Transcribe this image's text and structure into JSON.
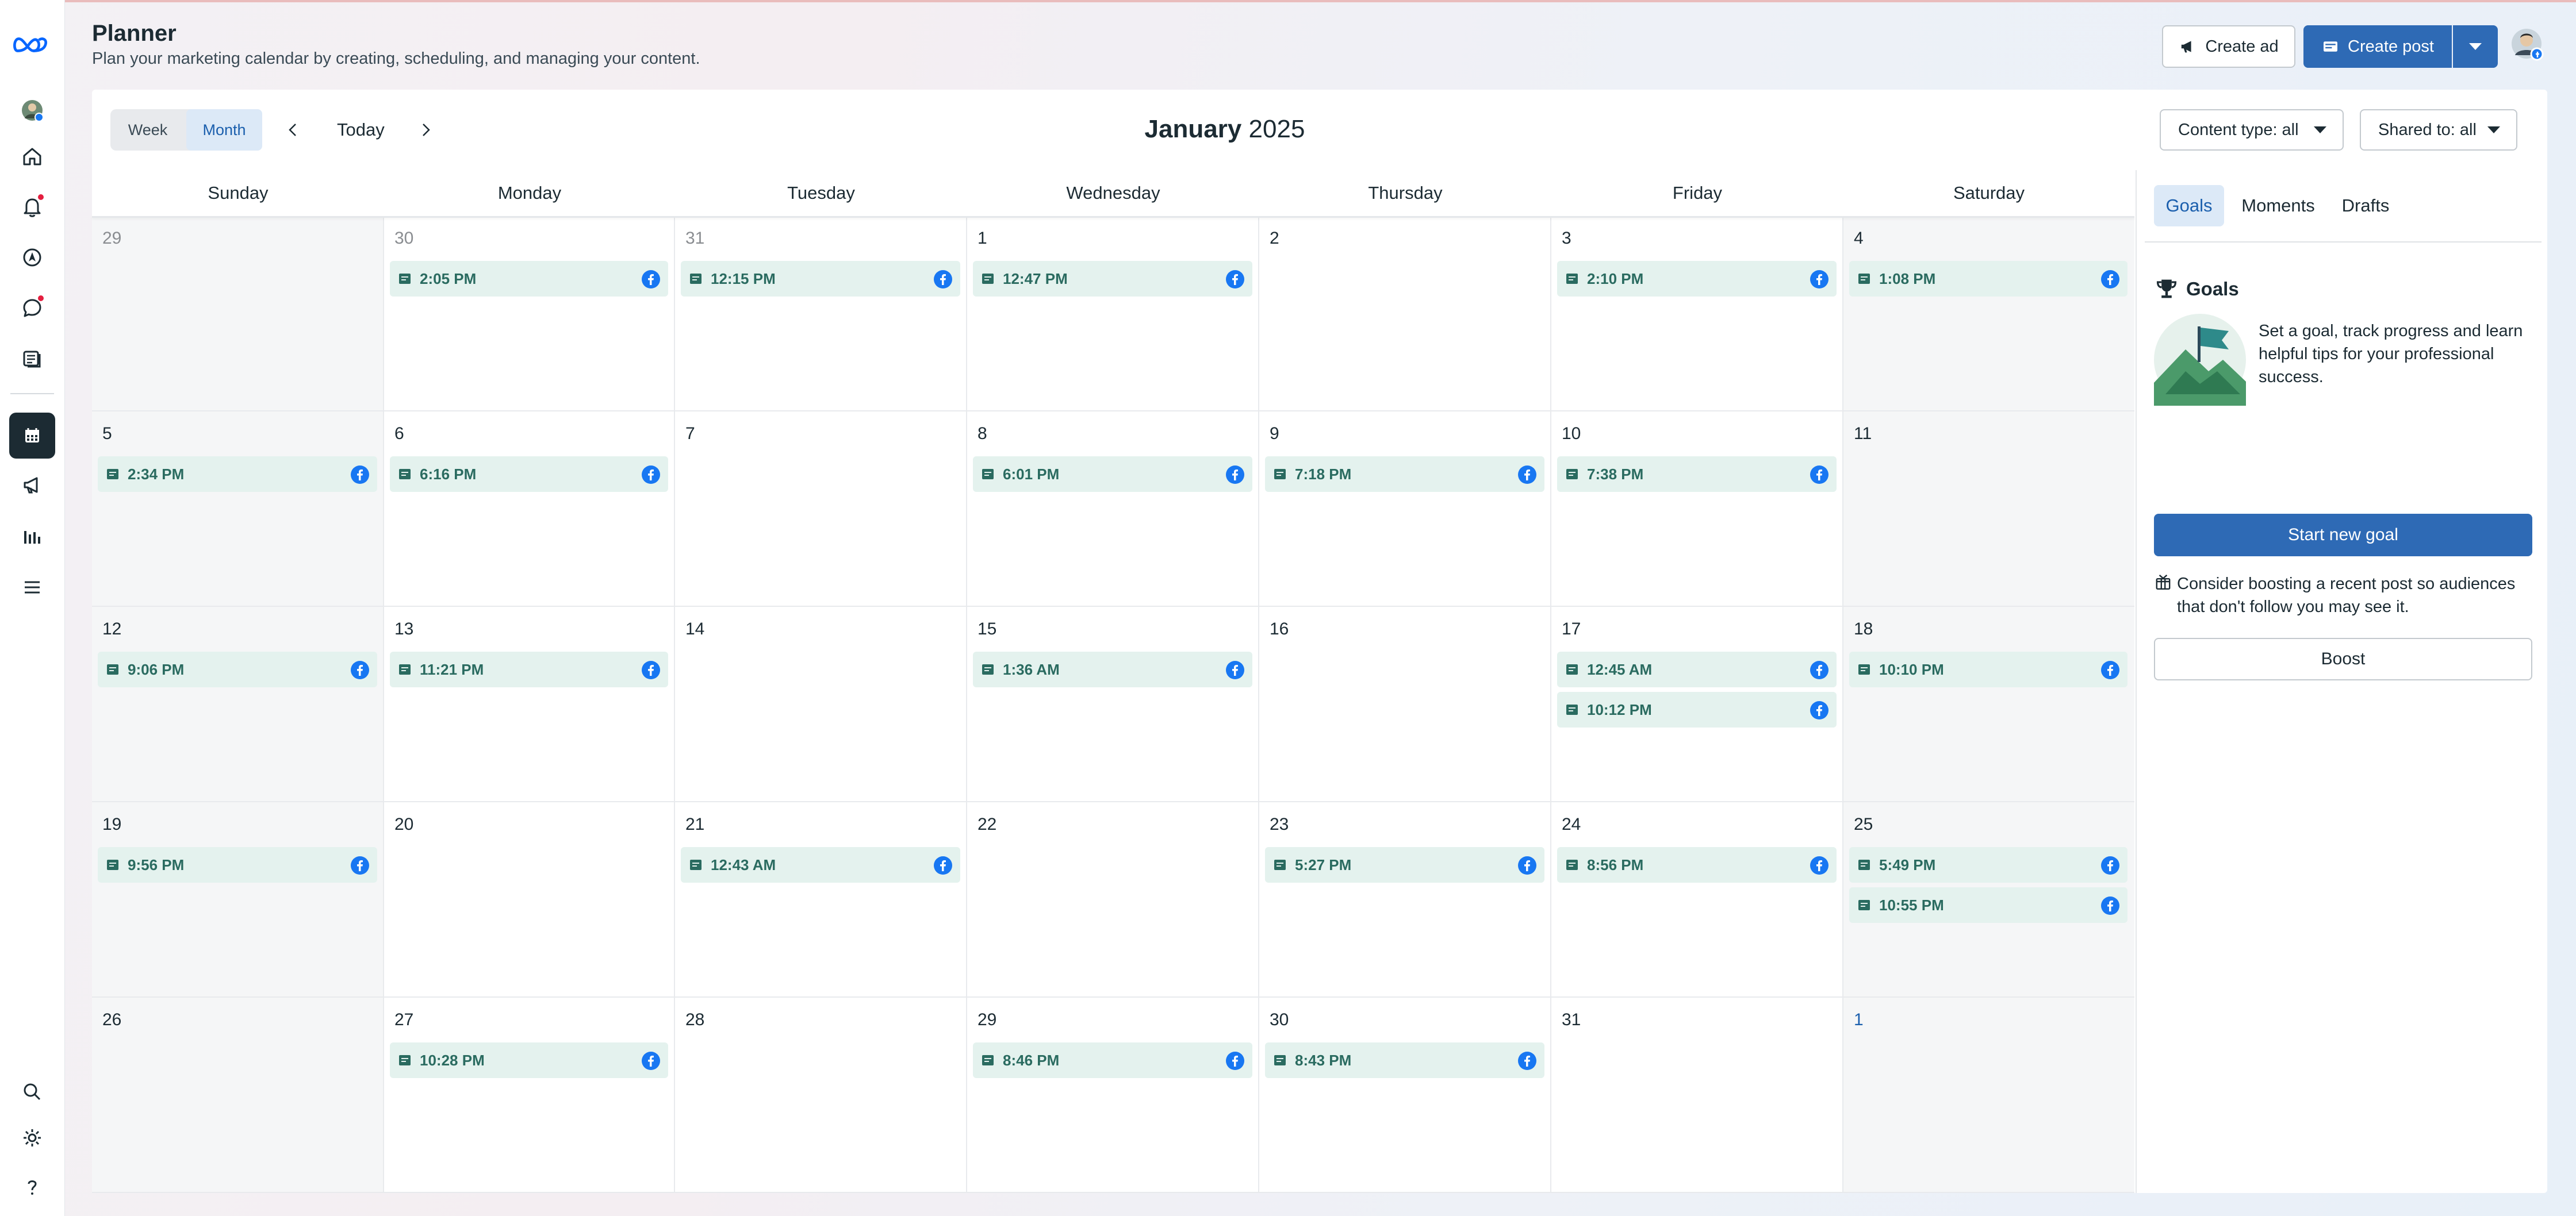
{
  "app": {
    "title": "Planner",
    "subtitle": "Plan your marketing calendar by creating, scheduling, and managing your content."
  },
  "header": {
    "create_ad_label": "Create ad",
    "create_post_label": "Create post"
  },
  "toolbar": {
    "week_label": "Week",
    "month_label": "Month",
    "active_view": "Month",
    "today_label": "Today",
    "month_name": "January",
    "year": "2025",
    "content_type_label": "Content type: all",
    "shared_to_label": "Shared to: all"
  },
  "calendar": {
    "days_of_week": [
      "Sunday",
      "Monday",
      "Tuesday",
      "Wednesday",
      "Thursday",
      "Friday",
      "Saturday"
    ],
    "weeks": [
      [
        {
          "day": "29",
          "muted": true,
          "shaded": true,
          "events": []
        },
        {
          "day": "30",
          "muted": true,
          "events": [
            "2:05 PM"
          ]
        },
        {
          "day": "31",
          "muted": true,
          "events": [
            "12:15 PM"
          ]
        },
        {
          "day": "1",
          "events": [
            "12:47 PM"
          ]
        },
        {
          "day": "2",
          "events": []
        },
        {
          "day": "3",
          "events": [
            "2:10 PM"
          ]
        },
        {
          "day": "4",
          "shaded": true,
          "events": [
            "1:08 PM"
          ]
        }
      ],
      [
        {
          "day": "5",
          "shaded": true,
          "events": [
            "2:34 PM"
          ]
        },
        {
          "day": "6",
          "events": [
            "6:16 PM"
          ]
        },
        {
          "day": "7",
          "events": []
        },
        {
          "day": "8",
          "events": [
            "6:01 PM"
          ]
        },
        {
          "day": "9",
          "events": [
            "7:18 PM"
          ]
        },
        {
          "day": "10",
          "events": [
            "7:38 PM"
          ]
        },
        {
          "day": "11",
          "shaded": true,
          "events": []
        }
      ],
      [
        {
          "day": "12",
          "shaded": true,
          "events": [
            "9:06 PM"
          ]
        },
        {
          "day": "13",
          "events": [
            "11:21 PM"
          ]
        },
        {
          "day": "14",
          "events": []
        },
        {
          "day": "15",
          "events": [
            "1:36 AM"
          ]
        },
        {
          "day": "16",
          "events": []
        },
        {
          "day": "17",
          "events": [
            "12:45 AM",
            "10:12 PM"
          ]
        },
        {
          "day": "18",
          "shaded": true,
          "events": [
            "10:10 PM"
          ]
        }
      ],
      [
        {
          "day": "19",
          "shaded": true,
          "events": [
            "9:56 PM"
          ]
        },
        {
          "day": "20",
          "events": []
        },
        {
          "day": "21",
          "events": [
            "12:43 AM"
          ]
        },
        {
          "day": "22",
          "events": []
        },
        {
          "day": "23",
          "events": [
            "5:27 PM"
          ]
        },
        {
          "day": "24",
          "events": [
            "8:56 PM"
          ]
        },
        {
          "day": "25",
          "shaded": true,
          "events": [
            "5:49 PM",
            "10:55 PM"
          ]
        }
      ],
      [
        {
          "day": "26",
          "shaded": true,
          "events": []
        },
        {
          "day": "27",
          "events": [
            "10:28 PM"
          ]
        },
        {
          "day": "28",
          "events": []
        },
        {
          "day": "29",
          "events": [
            "8:46 PM"
          ]
        },
        {
          "day": "30",
          "events": [
            "8:43 PM"
          ]
        },
        {
          "day": "31",
          "events": []
        },
        {
          "day": "1",
          "blue": true,
          "shaded": true,
          "events": []
        }
      ]
    ]
  },
  "panel": {
    "tabs": [
      "Goals",
      "Moments",
      "Drafts"
    ],
    "active_tab": "Goals",
    "goals_title": "Goals",
    "goals_text": "Set a goal, track progress and learn helpful tips for your professional success.",
    "start_goal_label": "Start new goal",
    "boost_text": "Consider boosting a recent post so audiences that don't follow you may see it.",
    "boost_label": "Boost"
  },
  "colors": {
    "primary": "#2e6ab5",
    "event_bg": "#e4f2ee",
    "event_text": "#2a6b60",
    "facebook": "#1877f2",
    "notification": "#e41e3f"
  },
  "icons": {
    "rail": [
      "meta-logo-icon",
      "profile-avatar",
      "home-icon",
      "bell-icon",
      "compass-icon",
      "chat-icon",
      "posts-icon",
      "calendar-icon",
      "megaphone-icon",
      "insights-icon",
      "menu-icon",
      "search-icon",
      "gear-icon",
      "help-icon"
    ]
  }
}
